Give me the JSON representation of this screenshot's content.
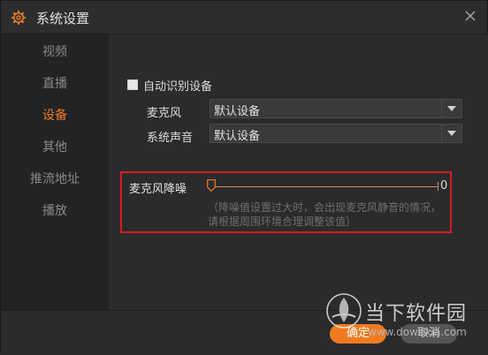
{
  "window": {
    "title": "系统设置"
  },
  "sidebar": {
    "items": [
      {
        "label": "视频"
      },
      {
        "label": "直播"
      },
      {
        "label": "设备"
      },
      {
        "label": "其他"
      },
      {
        "label": "推流地址"
      },
      {
        "label": "播放"
      }
    ],
    "active_index": 2
  },
  "device": {
    "auto_detect_label": "自动识别设备",
    "auto_detect_checked": false,
    "mic_label": "麦克风",
    "mic_value": "默认设备",
    "system_sound_label": "系统声音",
    "system_sound_value": "默认设备"
  },
  "noise_reduction": {
    "label": "麦克风降噪",
    "value": "0",
    "hint_line1": "（降噪值设置过大时，会出现麦克风静音的情况，",
    "hint_line2": "请根据周围环境合理调整该值）"
  },
  "footer": {
    "ok_label": "确定",
    "cancel_label": "取消"
  },
  "watermark": {
    "brand_cn": "当下软件园",
    "brand_en": "www.downxia.com"
  },
  "colors": {
    "accent": "#ef7b22",
    "highlight": "#d41d1d"
  },
  "icons": {
    "title": "gear-icon",
    "close": "close-icon",
    "dropdown": "caret-down-icon"
  }
}
